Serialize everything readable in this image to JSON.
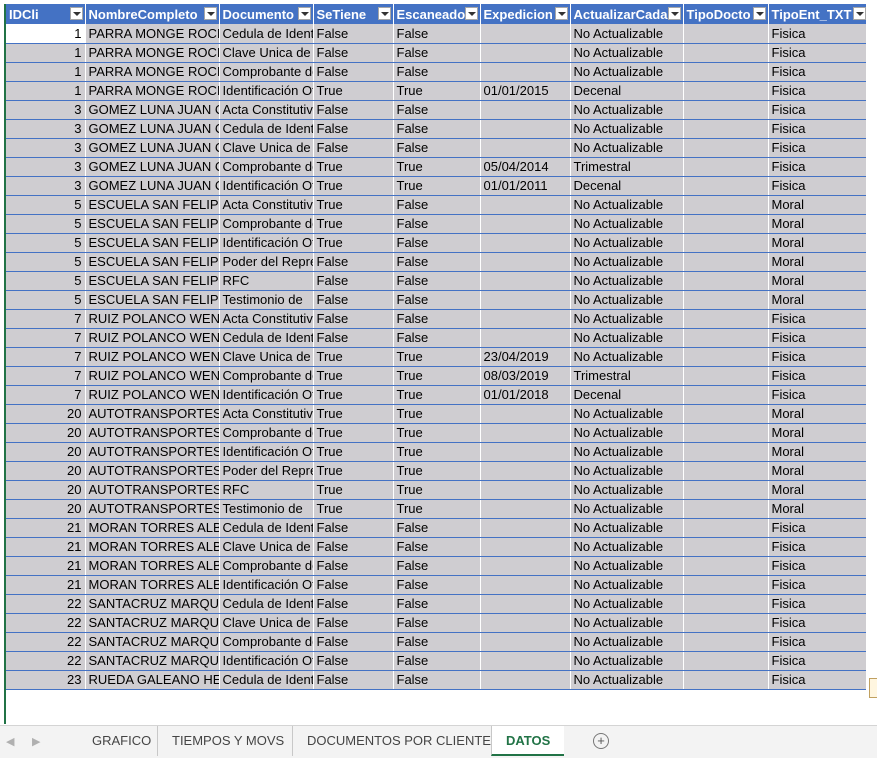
{
  "headers": [
    "IDCli",
    "NombreCompleto",
    "Documento",
    "SeTiene",
    "Escaneado",
    "Expedicion",
    "ActualizarCada",
    "TipoDocto",
    "TipoEnt_TXT"
  ],
  "rows": [
    [
      "1",
      "PARRA MONGE ROCIO",
      "Cedula de Identidad",
      "False",
      "False",
      "",
      "No Actualizable",
      "",
      "Fisica"
    ],
    [
      "1",
      "PARRA MONGE ROCIO",
      "Clave Unica de",
      "False",
      "False",
      "",
      "No Actualizable",
      "",
      "Fisica"
    ],
    [
      "1",
      "PARRA MONGE ROCIO",
      "Comprobante de",
      "False",
      "False",
      "",
      "No Actualizable",
      "",
      "Fisica"
    ],
    [
      "1",
      "PARRA MONGE ROCIO",
      "Identificación Oficial",
      "True",
      "True",
      "01/01/2015",
      "Decenal",
      "",
      "Fisica"
    ],
    [
      "3",
      "GOMEZ LUNA JUAN CA",
      "Acta Constitutiva",
      "False",
      "False",
      "",
      "No Actualizable",
      "",
      "Fisica"
    ],
    [
      "3",
      "GOMEZ LUNA JUAN CA",
      "Cedula de Identidad",
      "False",
      "False",
      "",
      "No Actualizable",
      "",
      "Fisica"
    ],
    [
      "3",
      "GOMEZ LUNA JUAN CA",
      "Clave Unica de",
      "False",
      "False",
      "",
      "No Actualizable",
      "",
      "Fisica"
    ],
    [
      "3",
      "GOMEZ LUNA JUAN CA",
      "Comprobante de",
      "True",
      "True",
      "05/04/2014",
      "Trimestral",
      "",
      "Fisica"
    ],
    [
      "3",
      "GOMEZ LUNA JUAN CA",
      "Identificación Oficial",
      "True",
      "True",
      "01/01/2011",
      "Decenal",
      "",
      "Fisica"
    ],
    [
      "5",
      "ESCUELA SAN FELIPE E",
      "Acta Constitutiva",
      "True",
      "False",
      "",
      "No Actualizable",
      "",
      "Moral"
    ],
    [
      "5",
      "ESCUELA SAN FELIPE E",
      "Comprobante de",
      "True",
      "False",
      "",
      "No Actualizable",
      "",
      "Moral"
    ],
    [
      "5",
      "ESCUELA SAN FELIPE E",
      "Identificación Oficial",
      "True",
      "False",
      "",
      "No Actualizable",
      "",
      "Moral"
    ],
    [
      "5",
      "ESCUELA SAN FELIPE E",
      "Poder del Representante",
      "False",
      "False",
      "",
      "No Actualizable",
      "",
      "Moral"
    ],
    [
      "5",
      "ESCUELA SAN FELIPE E",
      "RFC",
      "False",
      "False",
      "",
      "No Actualizable",
      "",
      "Moral"
    ],
    [
      "5",
      "ESCUELA SAN FELIPE E",
      "Testimonio de",
      "False",
      "False",
      "",
      "No Actualizable",
      "",
      "Moral"
    ],
    [
      "7",
      "RUIZ POLANCO WEND",
      "Acta Constitutiva",
      "False",
      "False",
      "",
      "No Actualizable",
      "",
      "Fisica"
    ],
    [
      "7",
      "RUIZ POLANCO WEND",
      "Cedula de Identidad",
      "False",
      "False",
      "",
      "No Actualizable",
      "",
      "Fisica"
    ],
    [
      "7",
      "RUIZ POLANCO WEND",
      "Clave Unica de",
      "True",
      "True",
      "23/04/2019",
      "No Actualizable",
      "",
      "Fisica"
    ],
    [
      "7",
      "RUIZ POLANCO WEND",
      "Comprobante de",
      "True",
      "True",
      "08/03/2019",
      "Trimestral",
      "",
      "Fisica"
    ],
    [
      "7",
      "RUIZ POLANCO WEND",
      "Identificación Oficial",
      "True",
      "True",
      "01/01/2018",
      "Decenal",
      "",
      "Fisica"
    ],
    [
      "20",
      "AUTOTRANSPORTES D",
      "Acta Constitutiva",
      "True",
      "True",
      "",
      "No Actualizable",
      "",
      "Moral"
    ],
    [
      "20",
      "AUTOTRANSPORTES D",
      "Comprobante de",
      "True",
      "True",
      "",
      "No Actualizable",
      "",
      "Moral"
    ],
    [
      "20",
      "AUTOTRANSPORTES D",
      "Identificación Oficial",
      "True",
      "True",
      "",
      "No Actualizable",
      "",
      "Moral"
    ],
    [
      "20",
      "AUTOTRANSPORTES D",
      "Poder del Representante",
      "True",
      "True",
      "",
      "No Actualizable",
      "",
      "Moral"
    ],
    [
      "20",
      "AUTOTRANSPORTES D",
      "RFC",
      "True",
      "True",
      "",
      "No Actualizable",
      "",
      "Moral"
    ],
    [
      "20",
      "AUTOTRANSPORTES D",
      "Testimonio de",
      "True",
      "True",
      "",
      "No Actualizable",
      "",
      "Moral"
    ],
    [
      "21",
      "MORAN TORRES ALBE",
      "Cedula de Identidad",
      "False",
      "False",
      "",
      "No Actualizable",
      "",
      "Fisica"
    ],
    [
      "21",
      "MORAN TORRES ALBE",
      "Clave Unica de",
      "False",
      "False",
      "",
      "No Actualizable",
      "",
      "Fisica"
    ],
    [
      "21",
      "MORAN TORRES ALBE",
      "Comprobante de",
      "False",
      "False",
      "",
      "No Actualizable",
      "",
      "Fisica"
    ],
    [
      "21",
      "MORAN TORRES ALBE",
      "Identificación Oficial",
      "False",
      "False",
      "",
      "No Actualizable",
      "",
      "Fisica"
    ],
    [
      "22",
      "SANTACRUZ MARQUE",
      "Cedula de Identidad",
      "False",
      "False",
      "",
      "No Actualizable",
      "",
      "Fisica"
    ],
    [
      "22",
      "SANTACRUZ MARQUE",
      "Clave Unica de",
      "False",
      "False",
      "",
      "No Actualizable",
      "",
      "Fisica"
    ],
    [
      "22",
      "SANTACRUZ MARQUE",
      "Comprobante de",
      "False",
      "False",
      "",
      "No Actualizable",
      "",
      "Fisica"
    ],
    [
      "22",
      "SANTACRUZ MARQUE",
      "Identificación Oficial",
      "False",
      "False",
      "",
      "No Actualizable",
      "",
      "Fisica"
    ],
    [
      "23",
      "RUEDA GALEANO HER",
      "Cedula de Identidad",
      "False",
      "False",
      "",
      "No Actualizable",
      "",
      "Fisica"
    ]
  ],
  "sheet_tabs": [
    "GRAFICO",
    "TIEMPOS Y MOVS",
    "DOCUMENTOS POR CLIENTE",
    "DATOS"
  ],
  "active_tab": "DATOS",
  "add_sheet_icon": "plus-circle-icon",
  "colors": {
    "header_bg": "#4472c4",
    "cell_bg": "#cfcdd1",
    "active_tab": "#217346"
  }
}
